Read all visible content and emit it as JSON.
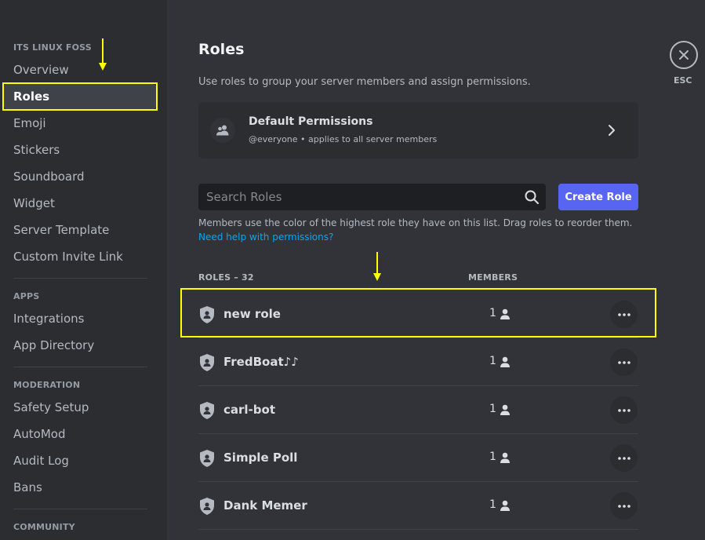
{
  "sidebar": {
    "server_header": "ITS LINUX FOSS",
    "server_items": [
      {
        "label": "Overview"
      },
      {
        "label": "Roles"
      },
      {
        "label": "Emoji"
      },
      {
        "label": "Stickers"
      },
      {
        "label": "Soundboard"
      },
      {
        "label": "Widget"
      },
      {
        "label": "Server Template"
      },
      {
        "label": "Custom Invite Link"
      }
    ],
    "apps_header": "APPS",
    "apps_items": [
      {
        "label": "Integrations"
      },
      {
        "label": "App Directory"
      }
    ],
    "moderation_header": "MODERATION",
    "moderation_items": [
      {
        "label": "Safety Setup"
      },
      {
        "label": "AutoMod"
      },
      {
        "label": "Audit Log"
      },
      {
        "label": "Bans"
      }
    ],
    "community_header": "COMMUNITY",
    "active_item": "Roles"
  },
  "main": {
    "title": "Roles",
    "description": "Use roles to group your server members and assign permissions.",
    "default_permissions": {
      "title": "Default Permissions",
      "subtitle": "@everyone • applies to all server members",
      "icon": "people-icon"
    },
    "search": {
      "placeholder": "Search Roles"
    },
    "create_role_label": "Create Role",
    "hint": "Members use the color of the highest role they have on this list. Drag roles to reorder them.",
    "help_link": "Need help with permissions?",
    "columns": {
      "roles": "ROLES – 32",
      "members": "MEMBERS"
    },
    "roles": [
      {
        "name": "new role",
        "members": "1"
      },
      {
        "name": "FredBoat♪♪",
        "members": "1"
      },
      {
        "name": "carl-bot",
        "members": "1"
      },
      {
        "name": "Simple Poll",
        "members": "1"
      },
      {
        "name": "Dank Memer",
        "members": "1"
      }
    ]
  },
  "close": {
    "label": "ESC",
    "icon": "close-icon"
  },
  "colors": {
    "accent": "#5865f2",
    "link": "#00a8fc",
    "highlight": "#ffff00",
    "sidebar_bg": "#2b2d31",
    "main_bg": "#313338"
  }
}
